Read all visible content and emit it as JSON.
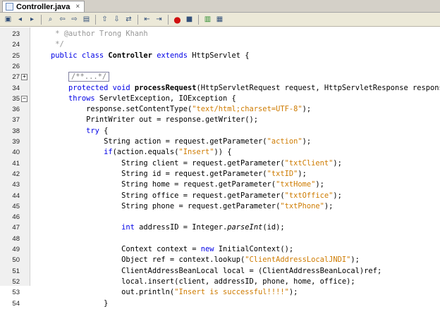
{
  "tab": {
    "filename": "Controller.java",
    "close": "×"
  },
  "toolbar_icons": [
    "toggle-bookmark-icon",
    "previous-icon",
    "next-icon",
    "find-icon",
    "find-prev-icon",
    "find-next-icon",
    "toggle-highlight-icon",
    "shift-left-icon",
    "shift-right-icon",
    "move-icon",
    "comment-icon",
    "uncomment-icon",
    "record-macro-icon",
    "stop-macro-icon",
    "diff-icon",
    "run-icon"
  ],
  "lines": [
    {
      "n": "23",
      "fold": "",
      "tokens": [
        {
          "t": "     * ",
          "c": "cm"
        },
        {
          "t": "@author",
          "c": "cm"
        },
        {
          "t": " Trong Khanh",
          "c": "cm"
        }
      ]
    },
    {
      "n": "24",
      "fold": "",
      "tokens": [
        {
          "t": "     */",
          "c": "cm"
        }
      ]
    },
    {
      "n": "25",
      "fold": "",
      "tokens": [
        {
          "t": "    ",
          "c": ""
        },
        {
          "t": "public class ",
          "c": "kw"
        },
        {
          "t": "Controller ",
          "c": "cls"
        },
        {
          "t": "extends ",
          "c": "kw"
        },
        {
          "t": "HttpServlet {",
          "c": ""
        }
      ]
    },
    {
      "n": "26",
      "fold": "",
      "tokens": []
    },
    {
      "n": "27",
      "fold": "+",
      "tokens": [
        {
          "t": "        ",
          "c": ""
        },
        {
          "t": "/**...*/",
          "c": "foldbox"
        }
      ]
    },
    {
      "n": "34",
      "fold": "",
      "tokens": [
        {
          "t": "        ",
          "c": ""
        },
        {
          "t": "protected void ",
          "c": "kw"
        },
        {
          "t": "processRequest",
          "c": "cls"
        },
        {
          "t": "(HttpServletRequest request, HttpServletResponse response)",
          "c": ""
        }
      ]
    },
    {
      "n": "35",
      "fold": "−",
      "tokens": [
        {
          "t": "        ",
          "c": ""
        },
        {
          "t": "throws ",
          "c": "kw"
        },
        {
          "t": "ServletException, IOException {",
          "c": ""
        }
      ]
    },
    {
      "n": "36",
      "fold": "",
      "tokens": [
        {
          "t": "            response.setContentType(",
          "c": ""
        },
        {
          "t": "\"text/html;charset=UTF-8\"",
          "c": "str"
        },
        {
          "t": ");",
          "c": ""
        }
      ]
    },
    {
      "n": "37",
      "fold": "",
      "tokens": [
        {
          "t": "            PrintWriter out = response.getWriter();",
          "c": ""
        }
      ]
    },
    {
      "n": "38",
      "fold": "",
      "tokens": [
        {
          "t": "            ",
          "c": ""
        },
        {
          "t": "try ",
          "c": "kw"
        },
        {
          "t": "{",
          "c": ""
        }
      ]
    },
    {
      "n": "39",
      "fold": "",
      "tokens": [
        {
          "t": "                String action = request.getParameter(",
          "c": ""
        },
        {
          "t": "\"action\"",
          "c": "str"
        },
        {
          "t": ");",
          "c": ""
        }
      ]
    },
    {
      "n": "40",
      "fold": "",
      "tokens": [
        {
          "t": "                ",
          "c": ""
        },
        {
          "t": "if",
          "c": "kw"
        },
        {
          "t": "(action.equals(",
          "c": ""
        },
        {
          "t": "\"Insert\"",
          "c": "str"
        },
        {
          "t": ")) {",
          "c": ""
        }
      ]
    },
    {
      "n": "41",
      "fold": "",
      "tokens": [
        {
          "t": "                    String client = request.getParameter(",
          "c": ""
        },
        {
          "t": "\"txtClient\"",
          "c": "str"
        },
        {
          "t": ");",
          "c": ""
        }
      ]
    },
    {
      "n": "42",
      "fold": "",
      "tokens": [
        {
          "t": "                    String id = request.getParameter(",
          "c": ""
        },
        {
          "t": "\"txtID\"",
          "c": "str"
        },
        {
          "t": ");",
          "c": ""
        }
      ]
    },
    {
      "n": "43",
      "fold": "",
      "tokens": [
        {
          "t": "                    String home = request.getParameter(",
          "c": ""
        },
        {
          "t": "\"txtHome\"",
          "c": "str"
        },
        {
          "t": ");",
          "c": ""
        }
      ]
    },
    {
      "n": "44",
      "fold": "",
      "tokens": [
        {
          "t": "                    String office = request.getParameter(",
          "c": ""
        },
        {
          "t": "\"txtOffice\"",
          "c": "str"
        },
        {
          "t": ");",
          "c": ""
        }
      ]
    },
    {
      "n": "45",
      "fold": "",
      "tokens": [
        {
          "t": "                    String phone = request.getParameter(",
          "c": ""
        },
        {
          "t": "\"txtPhone\"",
          "c": "str"
        },
        {
          "t": ");",
          "c": ""
        }
      ]
    },
    {
      "n": "46",
      "fold": "",
      "tokens": []
    },
    {
      "n": "47",
      "fold": "",
      "tokens": [
        {
          "t": "                    ",
          "c": ""
        },
        {
          "t": "int ",
          "c": "kw"
        },
        {
          "t": "addressID = Integer.",
          "c": ""
        },
        {
          "t": "parseInt",
          "c": "it"
        },
        {
          "t": "(id);",
          "c": ""
        }
      ]
    },
    {
      "n": "48",
      "fold": "",
      "tokens": []
    },
    {
      "n": "49",
      "fold": "",
      "tokens": [
        {
          "t": "                    Context context = ",
          "c": ""
        },
        {
          "t": "new ",
          "c": "kw"
        },
        {
          "t": "InitialContext();",
          "c": ""
        }
      ]
    },
    {
      "n": "50",
      "fold": "",
      "tokens": [
        {
          "t": "                    Object ref = context.lookup(",
          "c": ""
        },
        {
          "t": "\"ClientAddressLocalJNDI\"",
          "c": "str"
        },
        {
          "t": ");",
          "c": ""
        }
      ]
    },
    {
      "n": "51",
      "fold": "",
      "tokens": [
        {
          "t": "                    ClientAddressBeanLocal local = (ClientAddressBeanLocal)ref;",
          "c": ""
        }
      ]
    },
    {
      "n": "52",
      "fold": "",
      "tokens": [
        {
          "t": "                    local.insert(client, addressID, phone, home, office);",
          "c": ""
        }
      ]
    },
    {
      "n": "53",
      "fold": "",
      "tokens": [
        {
          "t": "                    out.println(",
          "c": ""
        },
        {
          "t": "\"Insert is successful!!!!\"",
          "c": "str"
        },
        {
          "t": ");",
          "c": ""
        }
      ]
    },
    {
      "n": "54",
      "fold": "",
      "tokens": [
        {
          "t": "                }",
          "c": ""
        }
      ]
    }
  ]
}
